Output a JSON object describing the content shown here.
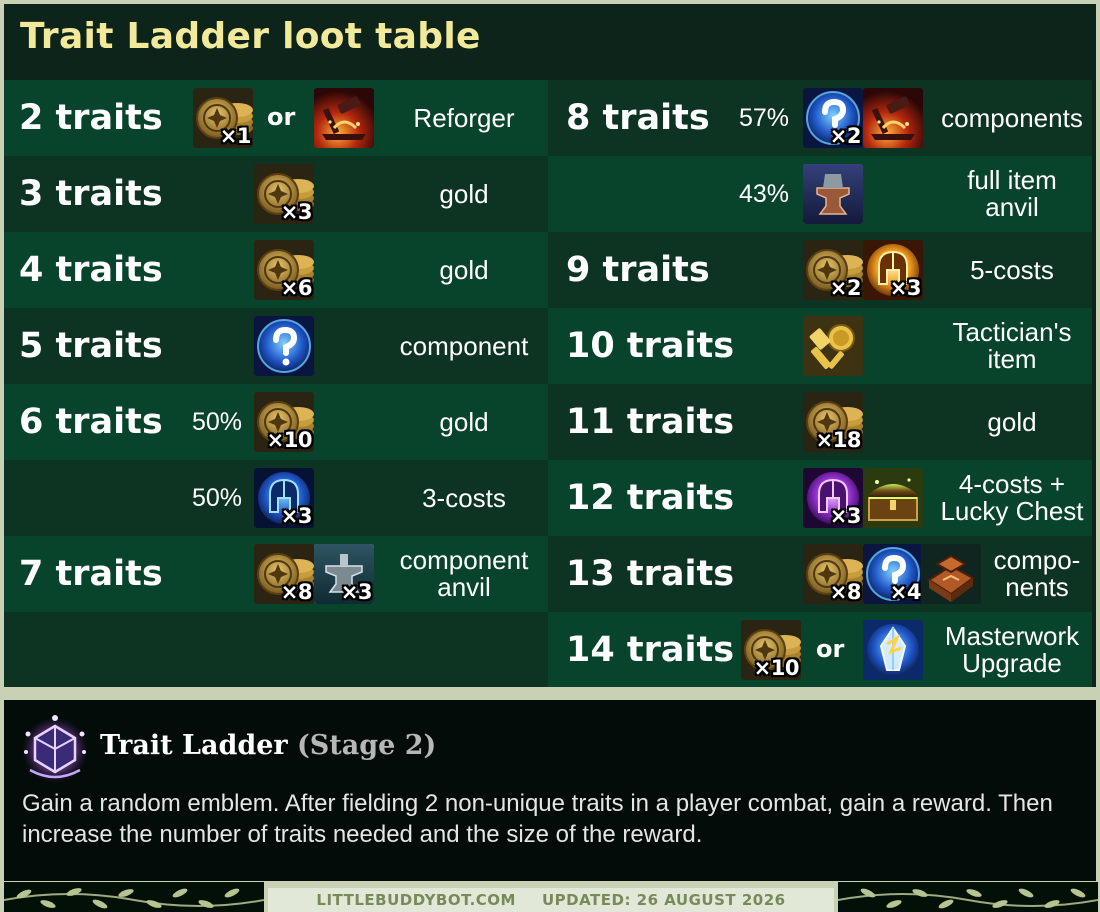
{
  "title": "Trait Ladder loot table",
  "rows_left": [
    {
      "traits": "2 traits",
      "mult1": "×1",
      "or": "or",
      "reward": "Reforger"
    },
    {
      "traits": "3 traits",
      "mult1": "×3",
      "reward": "gold"
    },
    {
      "traits": "4 traits",
      "mult1": "×6",
      "reward": "gold"
    },
    {
      "traits": "5 traits",
      "reward": "component"
    },
    {
      "traits": "6 traits",
      "pct": "50%",
      "mult1": "×10",
      "reward": "gold"
    },
    {
      "pct": "50%",
      "mult1": "×3",
      "reward": "3-costs"
    },
    {
      "traits": "7 traits",
      "mult1": "×8",
      "mult2": "×3",
      "reward": "component\nanvil"
    }
  ],
  "rows_right": [
    {
      "traits": "8 traits",
      "pct": "57%",
      "mult1": "×2",
      "reward": "components"
    },
    {
      "pct": "43%",
      "reward": "full item\nanvil"
    },
    {
      "traits": "9 traits",
      "mult1": "×2",
      "mult2": "×3",
      "reward": "5-costs"
    },
    {
      "traits": "10 traits",
      "reward": "Tactician's\nitem"
    },
    {
      "traits": "11 traits",
      "mult1": "×18",
      "reward": "gold"
    },
    {
      "traits": "12 traits",
      "mult1": "×3",
      "reward": "4-costs +\nLucky Chest"
    },
    {
      "traits": "13 traits",
      "mult1": "×8",
      "mult2": "×4",
      "reward": "compo-\nnents"
    },
    {
      "traits": "14 traits",
      "mult1": "×10",
      "or": "or",
      "reward": "Masterwork\nUpgrade"
    }
  ],
  "augment": {
    "name": "Trait Ladder",
    "stage": "(Stage 2)",
    "description": "Gain a random emblem. After fielding 2 non-unique traits in a player combat, gain a reward. Then increase the number of traits needed and the size of the reward."
  },
  "footer": {
    "site": "LITTLEBUDDYBOT.COM",
    "updated": "UPDATED: 26 AUGUST 2026"
  },
  "colors": {
    "title": "#f3e99a",
    "row_alt": "#08432b",
    "row_base": "#0d3322",
    "panel": "#0c2419",
    "frame": "#c9d1b4",
    "footer_text": "#78895a"
  },
  "icons": [
    "gold-coin-icon",
    "reforger-icon",
    "component-icon",
    "champion-3cost-icon",
    "component-anvil-icon",
    "full-item-anvil-icon",
    "champion-5cost-icon",
    "tactician-item-icon",
    "champion-4cost-icon",
    "lucky-chest-icon",
    "component-bundle-icon",
    "masterwork-upgrade-icon",
    "trait-ladder-augment-icon"
  ]
}
